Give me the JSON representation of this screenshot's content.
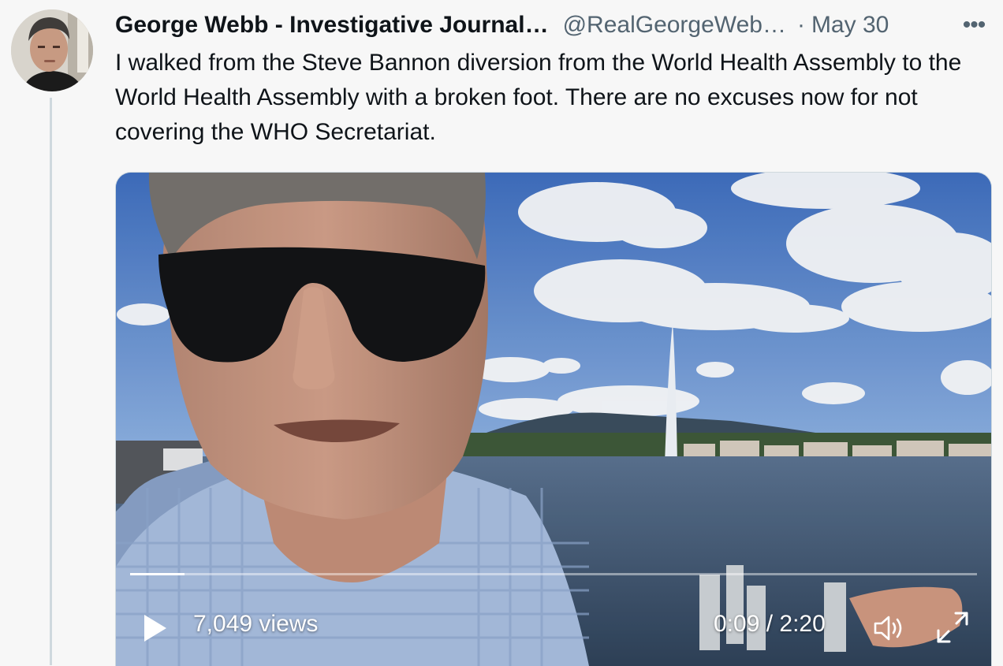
{
  "tweet": {
    "author_name": "George Webb - Investigative Journal…",
    "handle": "@RealGeorgeWeb…",
    "separator": "·",
    "date": "May 30",
    "more_label": "•••",
    "text": "I walked from the Steve Bannon diversion from the World Health Assembly to the World Health Assembly with a broken foot. There are no excuses now for not covering the WHO Secretariat."
  },
  "video": {
    "views": "7,049 views",
    "time": "0:09 / 2:20",
    "progress": 0.064
  },
  "icons": {
    "avatar": "avatar-photo",
    "more": "more-options-icon",
    "play": "play-icon",
    "volume": "volume-icon",
    "fullscreen": "fullscreen-icon"
  },
  "colors": {
    "background": "#f7f7f7",
    "text_primary": "#0f1419",
    "text_secondary": "#536471",
    "thread_line": "#cfd9de"
  }
}
